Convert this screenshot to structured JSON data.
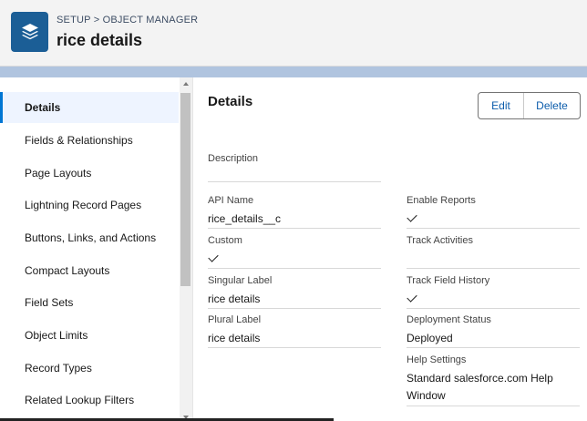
{
  "header": {
    "breadcrumb": "SETUP > OBJECT MANAGER",
    "title": "rice details",
    "app_icon": "layers-icon"
  },
  "sidebar": {
    "items": [
      {
        "label": "Details",
        "active": true
      },
      {
        "label": "Fields & Relationships"
      },
      {
        "label": "Page Layouts"
      },
      {
        "label": "Lightning Record Pages"
      },
      {
        "label": "Buttons, Links, and Actions"
      },
      {
        "label": "Compact Layouts"
      },
      {
        "label": "Field Sets"
      },
      {
        "label": "Object Limits"
      },
      {
        "label": "Record Types"
      },
      {
        "label": "Related Lookup Filters"
      }
    ]
  },
  "main": {
    "title": "Details",
    "buttons": {
      "edit": "Edit",
      "delete": "Delete"
    },
    "description": {
      "label": "Description",
      "value": ""
    },
    "left_fields": [
      {
        "label": "API Name",
        "value": "rice_details__c"
      },
      {
        "label": "Custom",
        "checked": true
      },
      {
        "label": "Singular Label",
        "value": "rice details"
      },
      {
        "label": "Plural Label",
        "value": "rice details"
      }
    ],
    "right_fields": [
      {
        "label": "Enable Reports",
        "checked": true
      },
      {
        "label": "Track Activities",
        "checked": false
      },
      {
        "label": "Track Field History",
        "checked": true
      },
      {
        "label": "Deployment Status",
        "value": "Deployed"
      },
      {
        "label": "Help Settings",
        "value_line1": "Standard salesforce.com Help",
        "value_line2": "Window"
      }
    ]
  },
  "colors": {
    "brand_icon": "#1b5e96",
    "link": "#0b5cab",
    "active_bar": "#0176d3",
    "header_band": "#b0c4df"
  }
}
